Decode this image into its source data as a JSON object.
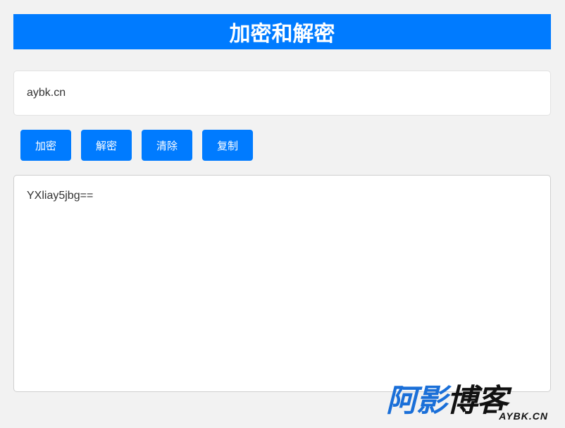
{
  "header": {
    "title": "加密和解密"
  },
  "input": {
    "value": "aybk.cn"
  },
  "buttons": {
    "encrypt": "加密",
    "decrypt": "解密",
    "clear": "清除",
    "copy": "复制"
  },
  "output": {
    "value": "YXliay5jbg=="
  },
  "watermark": {
    "cn_part1": "阿影",
    "cn_part2": "博客",
    "en": "AYBK.CN"
  },
  "colors": {
    "accent": "#007bff",
    "background": "#f2f2f2"
  }
}
